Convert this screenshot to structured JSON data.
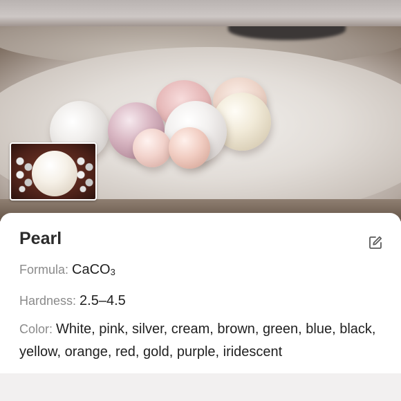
{
  "hero": {
    "image": "pearls-on-shell-photo"
  },
  "thumbnail": {
    "image": "pearl-with-silver-beads-photo"
  },
  "mineral": {
    "name": "Pearl",
    "formula_label": "Formula:",
    "formula_main": "CaCO",
    "formula_sub": "3",
    "hardness_label": "Hardness:",
    "hardness_value": "2.5–4.5",
    "color_label": "Color:",
    "color_value": "White, pink, silver, cream, brown, green, blue, black, yellow, orange, red, gold, purple, iridescent"
  },
  "icons": {
    "edit": "edit-icon"
  },
  "colors": {
    "title": "#2b2b2b",
    "label": "#8a8a8a",
    "value": "#1f1f1f"
  }
}
